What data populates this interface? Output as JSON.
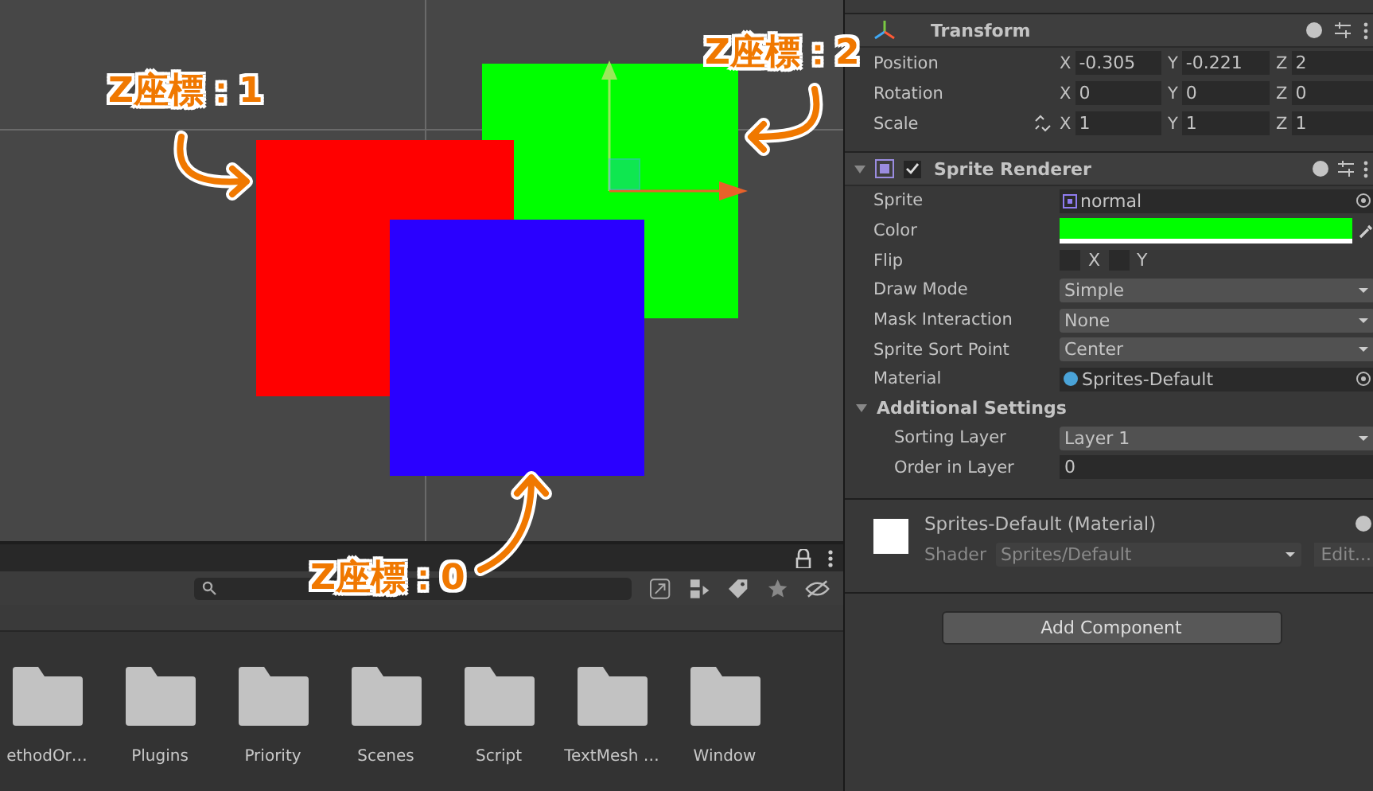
{
  "scene": {
    "sprites": [
      {
        "color": "#00ff00"
      },
      {
        "color": "#ff0000"
      },
      {
        "color": "#2a00ff"
      }
    ],
    "annotations": [
      {
        "label": "Z座標：1"
      },
      {
        "label": "Z座標：2"
      },
      {
        "label": "Z座標：0"
      }
    ]
  },
  "project_panel": {
    "folders": [
      {
        "name": "ethodOr…"
      },
      {
        "name": "Plugins"
      },
      {
        "name": "Priority"
      },
      {
        "name": "Scenes"
      },
      {
        "name": "Script"
      },
      {
        "name": "TextMesh …"
      },
      {
        "name": "Window"
      }
    ]
  },
  "inspector": {
    "transform": {
      "title": "Transform",
      "rows": [
        {
          "label": "Position",
          "fields": [
            {
              "axis": "X",
              "value": "-0.305"
            },
            {
              "axis": "Y",
              "value": "-0.221"
            },
            {
              "axis": "Z",
              "value": "2"
            }
          ]
        },
        {
          "label": "Rotation",
          "fields": [
            {
              "axis": "X",
              "value": "0"
            },
            {
              "axis": "Y",
              "value": "0"
            },
            {
              "axis": "Z",
              "value": "0"
            }
          ]
        },
        {
          "label": "Scale",
          "linked": false,
          "fields": [
            {
              "axis": "X",
              "value": "1"
            },
            {
              "axis": "Y",
              "value": "1"
            },
            {
              "axis": "Z",
              "value": "1"
            }
          ]
        }
      ]
    },
    "sprite_renderer": {
      "title": "Sprite Renderer",
      "enabled": true,
      "expanded": true,
      "properties": [
        {
          "kind": "object",
          "label": "Sprite",
          "value": "normal"
        },
        {
          "kind": "color",
          "label": "Color",
          "color": "#00ff00"
        },
        {
          "kind": "flip",
          "label": "Flip",
          "options": [
            {
              "label": "X",
              "checked": false
            },
            {
              "label": "Y",
              "checked": false
            }
          ]
        },
        {
          "kind": "dropdown",
          "label": "Draw Mode",
          "value": "Simple"
        },
        {
          "kind": "dropdown",
          "label": "Mask Interaction",
          "value": "None"
        },
        {
          "kind": "dropdown",
          "label": "Sprite Sort Point",
          "value": "Center"
        },
        {
          "kind": "material",
          "label": "Material",
          "value": "Sprites-Default"
        }
      ],
      "additional_settings": {
        "title": "Additional Settings",
        "expanded": true,
        "properties": [
          {
            "kind": "dropdown",
            "label": "Sorting Layer",
            "value": "Layer 1"
          },
          {
            "kind": "number",
            "label": "Order in Layer",
            "value": "0"
          }
        ]
      }
    },
    "material": {
      "title": "Sprites-Default (Material)",
      "shader_label": "Shader",
      "shader": "Sprites/Default",
      "edit_button": "Edit..."
    },
    "add_component": "Add Component"
  }
}
